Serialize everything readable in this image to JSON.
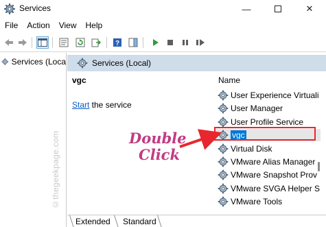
{
  "window": {
    "title": "Services",
    "minimize_glyph": "—",
    "close_glyph": "✕"
  },
  "menu": [
    "File",
    "Action",
    "View",
    "Help"
  ],
  "toolbar": {
    "icons": [
      "back-arrow-icon",
      "forward-arrow-icon",
      "show-hide-console-tree-icon",
      "properties-icon",
      "refresh-icon",
      "export-list-icon",
      "help-icon",
      "action-pane-icon",
      "start-service-icon",
      "stop-service-icon",
      "pause-service-icon",
      "restart-service-icon"
    ]
  },
  "tree": {
    "root_label": "Services (Loca"
  },
  "panel": {
    "header_label": "Services (Local)",
    "selected_service": "vgc",
    "action_link": "Start",
    "action_text": " the service"
  },
  "list": {
    "column_header": "Name",
    "rows": [
      "User Experience Virtuali",
      "User Manager",
      "User Profile Service",
      "vgc",
      "Virtual Disk",
      "VMware Alias Manager",
      "VMware Snapshot Prov",
      "VMware SVGA Helper S",
      "VMware Tools"
    ],
    "selected_index": 3
  },
  "tabs": [
    "Extended",
    "Standard"
  ],
  "annotation": {
    "line1": "Double",
    "line2": "Click",
    "color": "#c23a83",
    "highlight_color": "#e8262d"
  },
  "watermark": "©thegeekpage.com",
  "colors": {
    "header_band": "#cfdcea",
    "selection": "#0078d7",
    "link": "#0b5bc2"
  }
}
